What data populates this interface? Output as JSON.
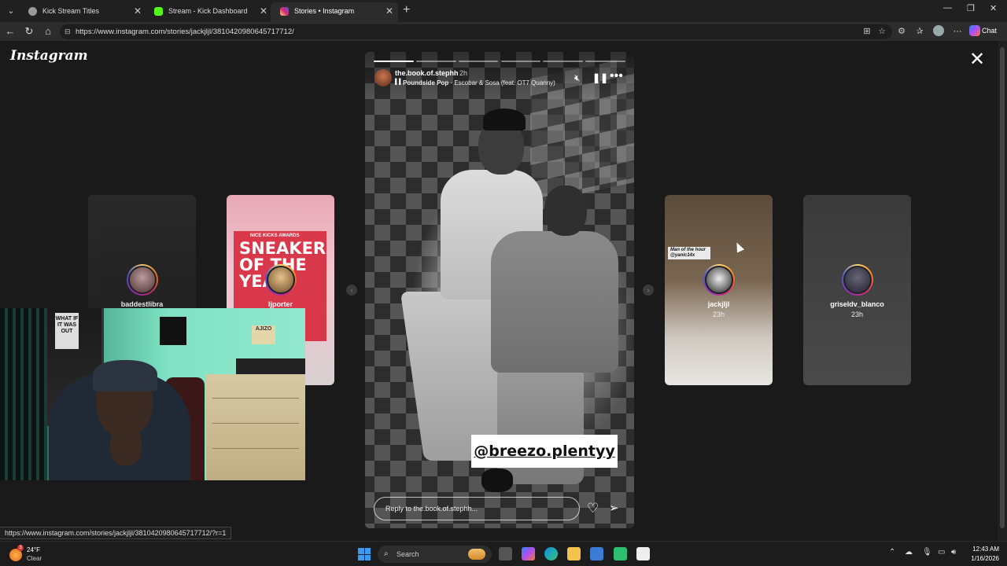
{
  "browser": {
    "tabs": [
      {
        "title": "Kick Stream Titles",
        "favicon_color": "#9a9a9a",
        "active": false
      },
      {
        "title": "Stream - Kick Dashboard",
        "favicon_color": "#53fc18",
        "active": false
      },
      {
        "title": "Stories • Instagram",
        "favicon_color": "#e1306c",
        "active": true
      }
    ],
    "url": "https://www.instagram.com/stories/jackjljl/3810420980645717712/",
    "chat_label": "Chat"
  },
  "instagram": {
    "logo": "Instagram",
    "main_story": {
      "username": "the.book.of.stephh",
      "time": "2h",
      "song": "Poundside Pop",
      "artist": " · Escobar & Sosa (feat. OT7 Quanny)",
      "tag_sticker": "@breezo.plentyy",
      "reply_placeholder": "Reply to the.book.of.stephh...",
      "progress_segments": 6,
      "progress_done": 1
    },
    "side_stories": [
      {
        "username": "baddestlibra",
        "time": ""
      },
      {
        "username": "ljporter",
        "time": "",
        "poster_text": "SNEAKER OF THE YEAR",
        "poster_small": "NICE KICKS AWARDS"
      },
      {
        "username": "jackjljl",
        "time": "23h",
        "sticker": "Man of the hour @yanic14x"
      },
      {
        "username": "griseldv_blanco",
        "time": "23h"
      }
    ]
  },
  "webcam": {
    "poster1": "WHAT IF IT WAS OUT",
    "poster3": "AJIZO"
  },
  "status_url": "https://www.instagram.com/stories/jackjljl/3810420980645717712/?r=1",
  "taskbar": {
    "weather_temp": "24°F",
    "weather_cond": "Clear",
    "weather_badge": "3",
    "search_label": "Search",
    "time": "12:43 AM",
    "date": "1/16/2026"
  }
}
